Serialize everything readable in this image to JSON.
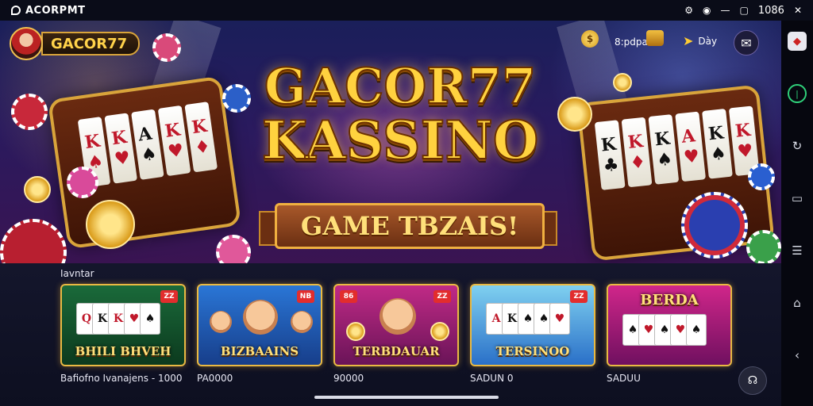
{
  "statusbar": {
    "app_name": "ACORPMT",
    "time": "1086",
    "icons": [
      "settings-icon",
      "wifi-icon",
      "minimize-icon",
      "window-icon",
      "close-icon"
    ]
  },
  "header": {
    "brand": "GACOR77",
    "hud_time": "8:pdpa",
    "hud_day": "Dày",
    "mail_icon": "mail-icon"
  },
  "hero": {
    "title_line1": "GACOR77",
    "title_line2": "KASSINO",
    "ribbon": "GAME TBZAIS!"
  },
  "section": {
    "title": "Iavntar"
  },
  "games": [
    {
      "title": "BHILI BHVEH",
      "badge_left": "",
      "badge_right": "ZZ",
      "caption": "Bafiofno Ivanajens - 1000"
    },
    {
      "title": "BIZBAAINS",
      "badge_left": "",
      "badge_right": "NB",
      "caption": "PA0000"
    },
    {
      "title": "TERBDAUAR",
      "badge_left": "86",
      "badge_right": "ZZ",
      "caption": "90000"
    },
    {
      "title": "TERSINOO",
      "badge_left": "",
      "badge_right": "ZZ",
      "caption": "SADUN 0"
    },
    {
      "title": "BERDA",
      "badge_left": "",
      "badge_right": "",
      "caption": "SADUU"
    }
  ],
  "rail": [
    "app-icon",
    "record-icon",
    "rotate-icon",
    "back-square-icon",
    "list-icon",
    "home-icon",
    "back-arrow-icon"
  ],
  "colors": {
    "accent_gold": "#e9b943",
    "badge_red": "#e22d2d",
    "rail_green": "#2fd07a"
  }
}
